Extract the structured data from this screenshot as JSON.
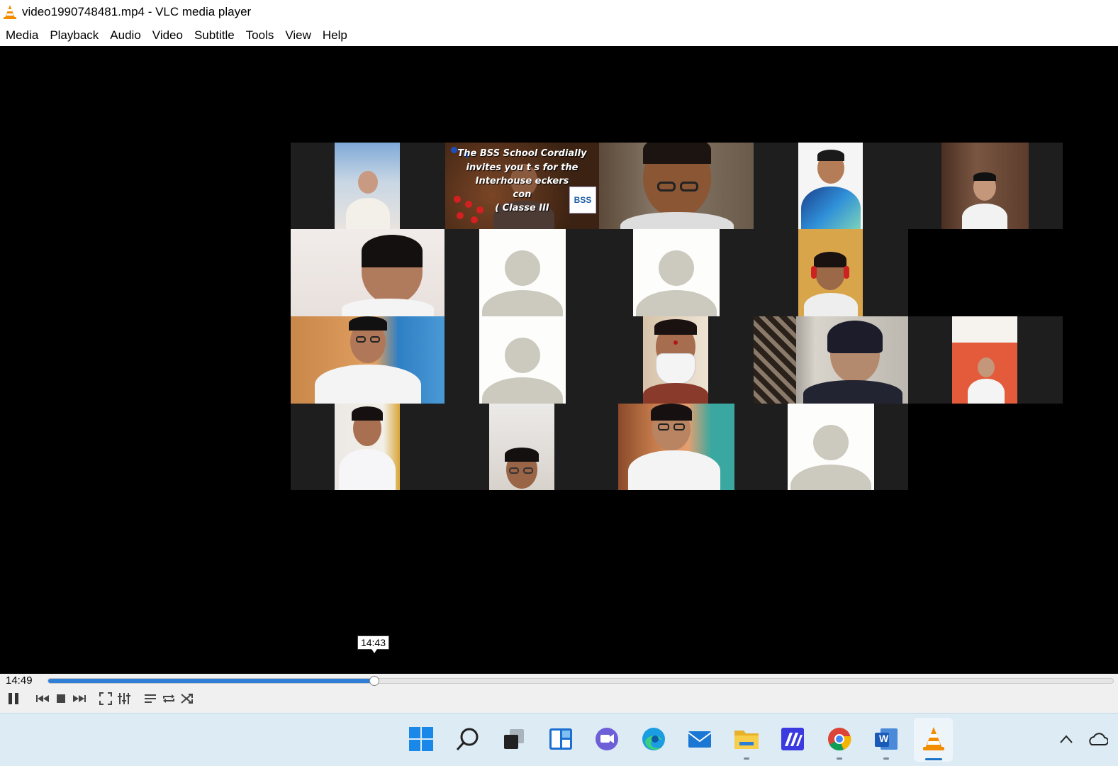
{
  "window": {
    "title": "video1990748481.mp4 - VLC media player"
  },
  "menu": {
    "items": [
      "Media",
      "Playback",
      "Audio",
      "Video",
      "Subtitle",
      "Tools",
      "View",
      "Help"
    ]
  },
  "video": {
    "banner": {
      "line1": "The BSS School Cordially",
      "line2": "invites you t       s for the",
      "line3": "Interhouse           eckers",
      "line4": "con",
      "line5": "( Classe       III",
      "logo_text": "BSS"
    }
  },
  "player": {
    "seek_tooltip": "14:43",
    "elapsed_time": "14:49",
    "progress_fraction": 0.306,
    "accent_color": "#2f7fd6"
  },
  "controls": {
    "buttons": [
      "pause-icon",
      "previous-icon",
      "stop-icon",
      "next-icon",
      "fullscreen-icon",
      "extended-settings-icon",
      "playlist-icon",
      "loop-icon",
      "shuffle-icon"
    ]
  },
  "taskbar": {
    "apps": [
      "start-icon",
      "search-icon",
      "task-view-icon",
      "widgets-icon",
      "chat-icon",
      "edge-icon",
      "mail-icon",
      "file-explorer-icon",
      "app-icon",
      "chrome-icon",
      "word-icon",
      "vlc-icon"
    ],
    "word_letter": "W"
  }
}
